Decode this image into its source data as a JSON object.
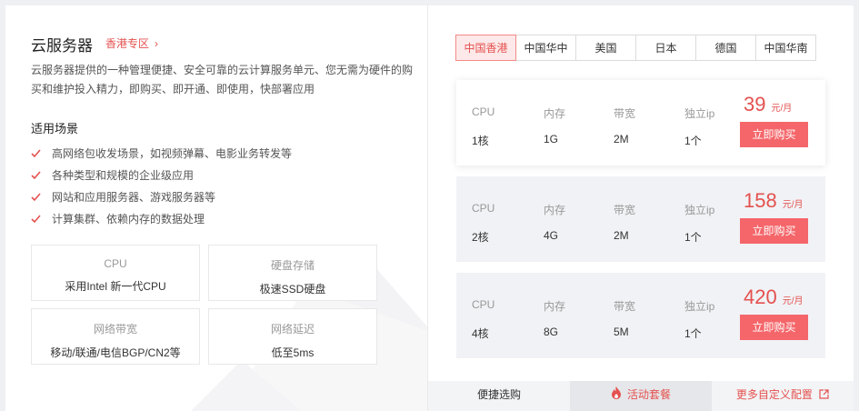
{
  "product": {
    "title": "云服务器",
    "region_link": "香港专区",
    "description": "云服务器提供的一种管理便捷、安全可靠的云计算服务单元、您无需为硬件的购买和维护投入精力，即购买、即开通、即使用，快部署应用"
  },
  "scenarios": {
    "title": "适用场景",
    "items": [
      "高网络包收发场景，如视频弹幕、电影业务转发等",
      "各种类型和规模的企业级应用",
      "网站和应用服务器、游戏服务器等",
      "计算集群、依赖内存的数据处理"
    ]
  },
  "features": [
    {
      "label": "CPU",
      "value": "采用Intel 新一代CPU"
    },
    {
      "label": "硬盘存储",
      "value": "极速SSD硬盘"
    },
    {
      "label": "网络带宽",
      "value": "移动/联通/电信BGP/CN2等"
    },
    {
      "label": "网络延迟",
      "value": "低至5ms"
    }
  ],
  "region_tabs": [
    "中国香港",
    "中国华中",
    "美国",
    "日本",
    "德国",
    "中国华南"
  ],
  "active_tab": "中国香港",
  "spec_labels": [
    "CPU",
    "内存",
    "带宽",
    "独立ip"
  ],
  "plans": [
    {
      "cpu": "1核",
      "memory": "1G",
      "bandwidth": "2M",
      "ip": "1个",
      "price": "39",
      "unit": "元/月",
      "buy_label": "立即购买"
    },
    {
      "cpu": "2核",
      "memory": "4G",
      "bandwidth": "2M",
      "ip": "1个",
      "price": "158",
      "unit": "元/月",
      "buy_label": "立即购买"
    },
    {
      "cpu": "4核",
      "memory": "8G",
      "bandwidth": "5M",
      "ip": "1个",
      "price": "420",
      "unit": "元/月",
      "buy_label": "立即购买"
    }
  ],
  "bottom_bar": {
    "quick_select": "便捷选购",
    "promo": "活动套餐",
    "custom_config": "更多自定义配置"
  },
  "colors": {
    "accent": "#e4514f",
    "buy_button": "#f4666a",
    "tab_active_bg": "#fde9e9",
    "plan_alt_bg": "#f1f2f5"
  },
  "icons": {
    "region_link": "chevron-right-icon",
    "scenario_bullet": "check-icon",
    "promo": "fire-icon",
    "custom_config": "external-link-icon"
  }
}
